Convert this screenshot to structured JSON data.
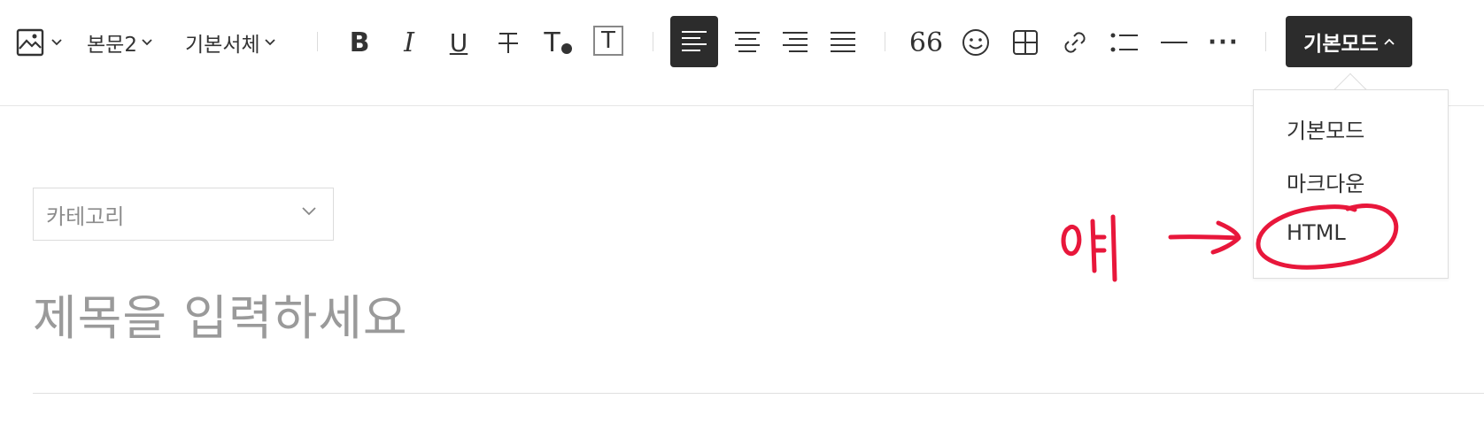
{
  "toolbar": {
    "image_icon": "image-icon",
    "paragraph_style": "본문2",
    "font_family": "기본서체",
    "bold": "B",
    "italic": "I",
    "underline": "U",
    "strike": "干",
    "text_color": "T",
    "text_bg": "T",
    "align_left": "align-left-icon",
    "align_center": "align-center-icon",
    "align_right": "align-right-icon",
    "align_justify": "align-justify-icon",
    "quote": "66",
    "more": "···",
    "mode_label": "기본모드"
  },
  "mode_menu": {
    "items": [
      "기본모드",
      "마크다운",
      "HTML"
    ]
  },
  "editor": {
    "category_placeholder": "카테고리",
    "title_placeholder": "제목을 입력하세요"
  },
  "annotation": {
    "handwritten_text": "얘",
    "color": "#e8173b"
  },
  "colors": {
    "active_bg": "#2c2c2c",
    "annotation": "#e8173b"
  }
}
